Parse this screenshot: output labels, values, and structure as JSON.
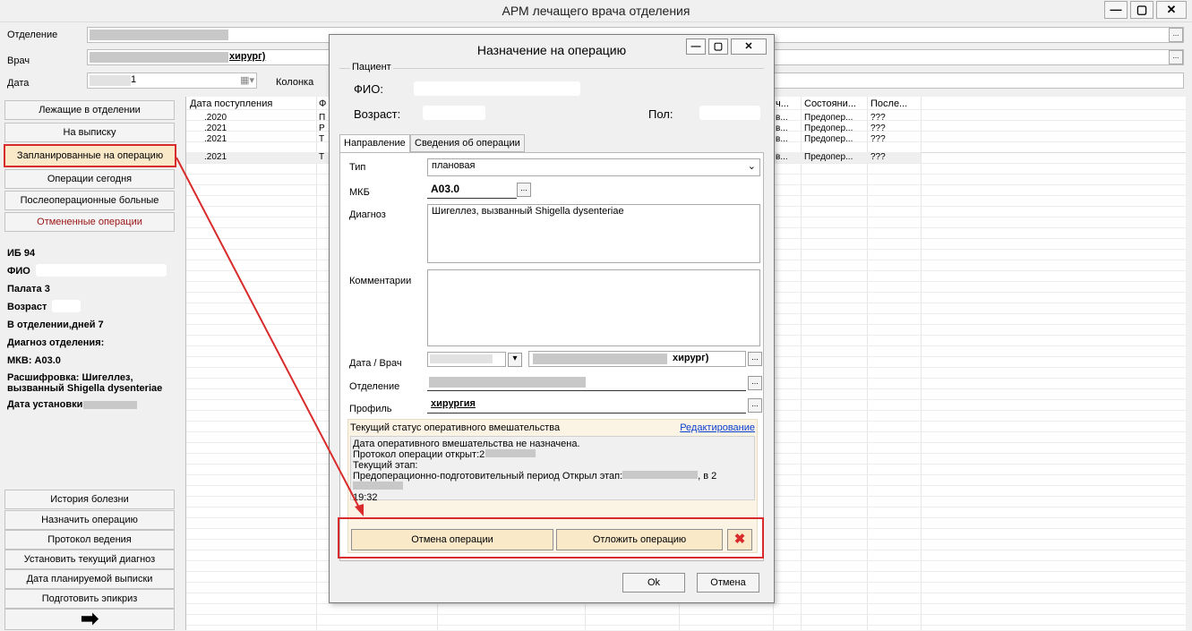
{
  "app": {
    "title": "АРМ лечащего врача отделения",
    "win_minimize": "—",
    "win_maximize": "▢",
    "win_close": "✕"
  },
  "filters": {
    "department_label": "Отделение",
    "doctor_label": "Врач",
    "doctor_value_suffix": "хирург)",
    "date_label": "Дата",
    "date_value": "1",
    "column_label": "Колонка"
  },
  "nav": {
    "in_department": "Лежащие в отделении",
    "discharge": "На выписку",
    "planned": "Запланированные на операцию",
    "today": "Операции сегодня",
    "postop": "Послеоперационные больные",
    "cancelled": "Отмененные операции"
  },
  "patient_info": {
    "ib": "ИБ 94",
    "fio_label": "ФИО",
    "ward": "Палата 3",
    "age_label": "Возраст",
    "days": "В отделении,дней 7",
    "diag_label": "Диагноз отделения:",
    "mkb": "МКВ: А03.0",
    "decode1": "Расшифровка: Шигеллез,",
    "decode2": "вызванный Shigella dysenteriae",
    "set_date_label": "Дата установки:"
  },
  "actions": {
    "history": "История болезни",
    "assign": "Назначить операцию",
    "protocol": "Протокол ведения",
    "set_diag": "Установить текущий диагноз",
    "discharge_date": "Дата планируемой выписки",
    "epicrisis": "Подготовить эпикриз",
    "arrow": "➡"
  },
  "grid": {
    "headers": [
      "Дата поступления",
      "Ф",
      "ч...",
      "Состояни...",
      "После..."
    ],
    "rows": [
      {
        "date": ".2020",
        "f": "П",
        "c": "в...",
        "state": "Предопер...",
        "post": "???"
      },
      {
        "date": ".2021",
        "f": "Р",
        "c": "в...",
        "state": "Предопер...",
        "post": "???"
      },
      {
        "date": ".2021",
        "f": "Т",
        "c": "в...",
        "state": "Предопер...",
        "post": "???"
      },
      {
        "date": ".2021",
        "f": "Т",
        "c": "в...",
        "state": "Предопер...",
        "post": "???"
      }
    ]
  },
  "dialog": {
    "title": "Назначение на операцию",
    "min": "—",
    "max": "▢",
    "close": "✕",
    "patient_group": "Пациент",
    "fio_label": "ФИО:",
    "age_label": "Возраст:",
    "sex_label": "Пол:",
    "tabs": [
      "Направление",
      "Сведения об операции"
    ],
    "type_label": "Тип",
    "type_value": "плановая",
    "mkb_label": "МКБ",
    "mkb_value": "А03.0",
    "diag_label": "Диагноз",
    "diag_value": "Шигеллез, вызванный Shigella dysenteriae",
    "comment_label": "Комментарии",
    "date_doctor_label": "Дата / Врач",
    "doctor_suffix": "хирург)",
    "department_label": "Отделение",
    "profile_label": "Профиль",
    "profile_value": "хирургия",
    "status_header": "Текущий статус оперативного вмешательства",
    "edit_link": "Редактирование",
    "status_lines": [
      "Дата оперативного вмешательства не назначена.",
      "Протокол операции открыт:2",
      "Текущий этап:",
      "Предоперационно-подготовительный период Открыл этап:",
      "19:32"
    ],
    "status_in": ", в 2",
    "cancel_op": "Отмена операции",
    "postpone_op": "Отложить операцию",
    "ok": "Ok",
    "cancel": "Отмена",
    "ellipsis": "..."
  },
  "colors": {
    "highlight": "#d92b2b",
    "nav_active_bg": "#f9e9c9",
    "link": "#0b3fd1"
  }
}
